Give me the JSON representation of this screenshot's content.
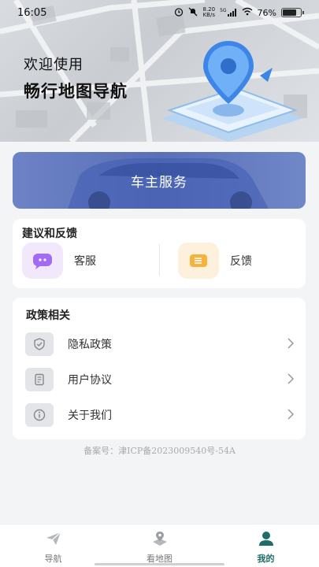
{
  "status_bar": {
    "time": "16:05",
    "speed_value": "8.20",
    "speed_unit": "KB/s",
    "network": "5G",
    "battery": "76%",
    "battery_level": 0.76
  },
  "hero": {
    "line1": "欢迎使用",
    "line2": "畅行地图导航"
  },
  "car_service": {
    "label": "车主服务"
  },
  "feedback": {
    "title": "建议和反馈",
    "items": [
      {
        "label": "客服",
        "icon": "chat-bubble-icon"
      },
      {
        "label": "反馈",
        "icon": "feedback-note-icon"
      }
    ]
  },
  "policy": {
    "title": "政策相关",
    "items": [
      {
        "label": "隐私政策",
        "icon": "shield-icon"
      },
      {
        "label": "用户协议",
        "icon": "document-icon"
      },
      {
        "label": "关于我们",
        "icon": "info-icon"
      }
    ]
  },
  "icp": "备案号：津ICP备2023009540号-54A",
  "bottom_nav": {
    "items": [
      {
        "label": "导航",
        "icon": "paper-plane-icon"
      },
      {
        "label": "看地图",
        "icon": "map-pin-icon"
      },
      {
        "label": "我的",
        "icon": "person-icon"
      }
    ],
    "active": "我的"
  },
  "colors": {
    "accent": "#1e6e67",
    "car_card": "#6d83c6",
    "policy_icon_bg": "#e4e5e8"
  }
}
